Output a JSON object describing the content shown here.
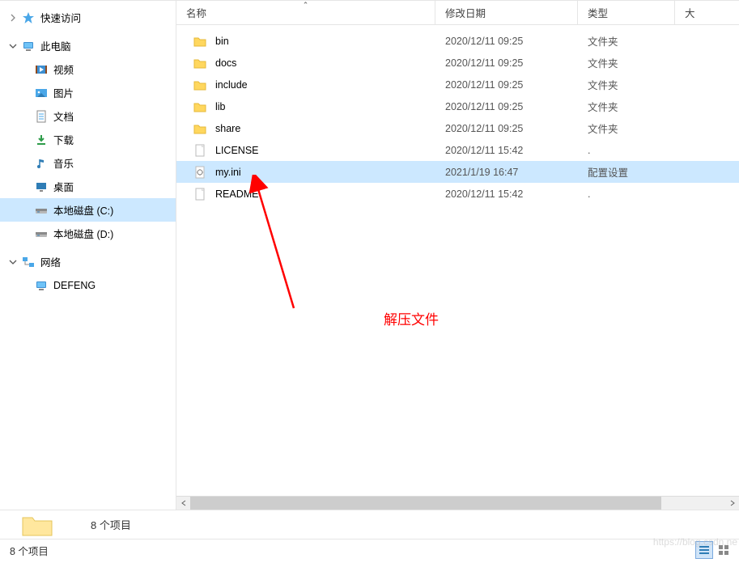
{
  "sidebar": {
    "quickAccess": {
      "label": "快速访问"
    },
    "thisPc": {
      "label": "此电脑",
      "children": [
        {
          "label": "视频"
        },
        {
          "label": "图片"
        },
        {
          "label": "文档"
        },
        {
          "label": "下载"
        },
        {
          "label": "音乐"
        },
        {
          "label": "桌面"
        },
        {
          "label": "本地磁盘 (C:)"
        },
        {
          "label": "本地磁盘 (D:)"
        }
      ]
    },
    "network": {
      "label": "网络",
      "children": [
        {
          "label": "DEFENG"
        }
      ]
    }
  },
  "columns": {
    "name": "名称",
    "date": "修改日期",
    "type": "类型",
    "size": "大"
  },
  "files": [
    {
      "name": "bin",
      "date": "2020/12/11 09:25",
      "type": "文件夹",
      "icon": "folder"
    },
    {
      "name": "docs",
      "date": "2020/12/11 09:25",
      "type": "文件夹",
      "icon": "folder"
    },
    {
      "name": "include",
      "date": "2020/12/11 09:25",
      "type": "文件夹",
      "icon": "folder"
    },
    {
      "name": "lib",
      "date": "2020/12/11 09:25",
      "type": "文件夹",
      "icon": "folder"
    },
    {
      "name": "share",
      "date": "2020/12/11 09:25",
      "type": "文件夹",
      "icon": "folder"
    },
    {
      "name": "LICENSE",
      "date": "2020/12/11 15:42",
      "type": ".",
      "icon": "file"
    },
    {
      "name": "my.ini",
      "date": "2021/1/19 16:47",
      "type": "配置设置",
      "icon": "ini",
      "selected": true
    },
    {
      "name": "README",
      "date": "2020/12/11 15:42",
      "type": ".",
      "icon": "file"
    }
  ],
  "annotation": "解压文件",
  "statusTop": "8 个项目",
  "statusBottom": "8 个项目",
  "watermark": "https://blog.csdn.ne"
}
